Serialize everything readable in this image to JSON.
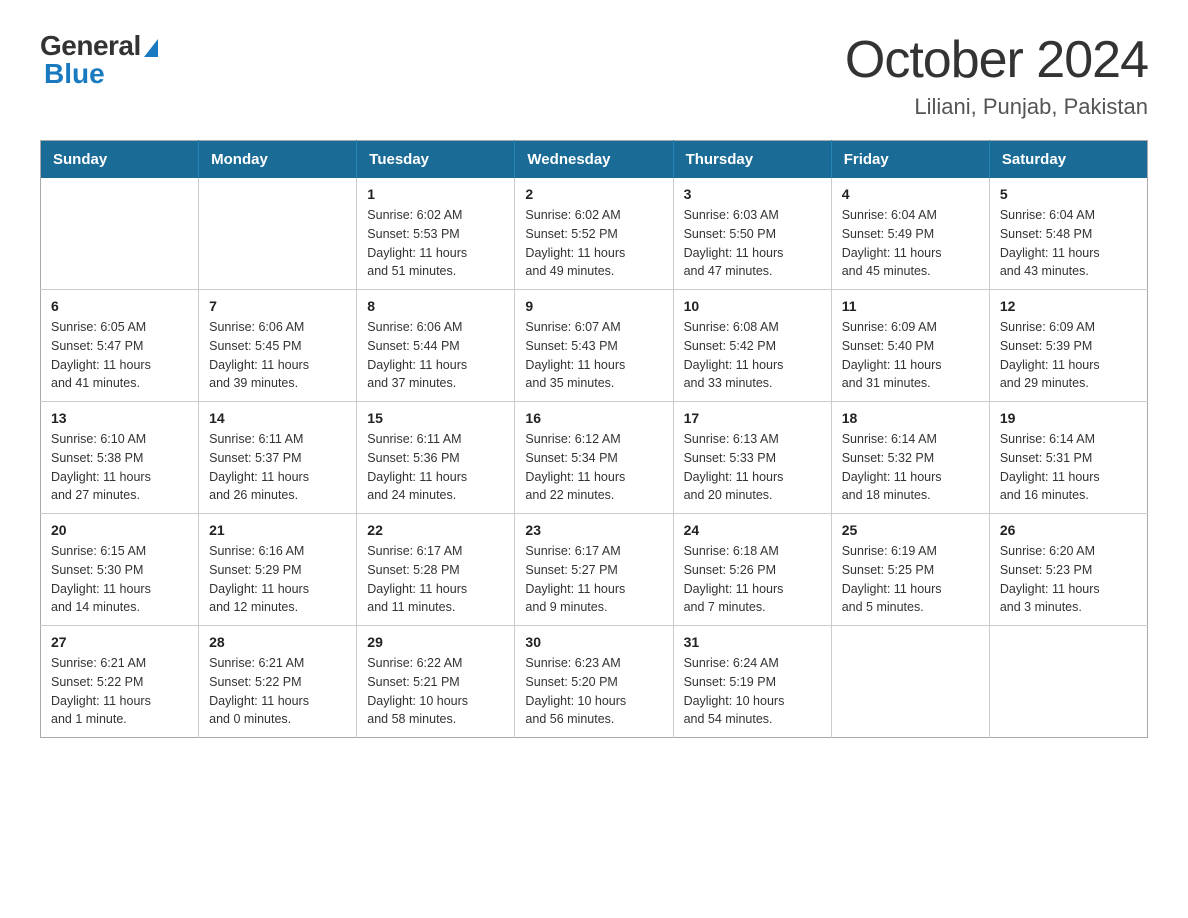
{
  "logo": {
    "general": "General",
    "blue": "Blue"
  },
  "title": "October 2024",
  "subtitle": "Liliani, Punjab, Pakistan",
  "weekdays": [
    "Sunday",
    "Monday",
    "Tuesday",
    "Wednesday",
    "Thursday",
    "Friday",
    "Saturday"
  ],
  "weeks": [
    [
      {
        "day": "",
        "info": ""
      },
      {
        "day": "",
        "info": ""
      },
      {
        "day": "1",
        "info": "Sunrise: 6:02 AM\nSunset: 5:53 PM\nDaylight: 11 hours\nand 51 minutes."
      },
      {
        "day": "2",
        "info": "Sunrise: 6:02 AM\nSunset: 5:52 PM\nDaylight: 11 hours\nand 49 minutes."
      },
      {
        "day": "3",
        "info": "Sunrise: 6:03 AM\nSunset: 5:50 PM\nDaylight: 11 hours\nand 47 minutes."
      },
      {
        "day": "4",
        "info": "Sunrise: 6:04 AM\nSunset: 5:49 PM\nDaylight: 11 hours\nand 45 minutes."
      },
      {
        "day": "5",
        "info": "Sunrise: 6:04 AM\nSunset: 5:48 PM\nDaylight: 11 hours\nand 43 minutes."
      }
    ],
    [
      {
        "day": "6",
        "info": "Sunrise: 6:05 AM\nSunset: 5:47 PM\nDaylight: 11 hours\nand 41 minutes."
      },
      {
        "day": "7",
        "info": "Sunrise: 6:06 AM\nSunset: 5:45 PM\nDaylight: 11 hours\nand 39 minutes."
      },
      {
        "day": "8",
        "info": "Sunrise: 6:06 AM\nSunset: 5:44 PM\nDaylight: 11 hours\nand 37 minutes."
      },
      {
        "day": "9",
        "info": "Sunrise: 6:07 AM\nSunset: 5:43 PM\nDaylight: 11 hours\nand 35 minutes."
      },
      {
        "day": "10",
        "info": "Sunrise: 6:08 AM\nSunset: 5:42 PM\nDaylight: 11 hours\nand 33 minutes."
      },
      {
        "day": "11",
        "info": "Sunrise: 6:09 AM\nSunset: 5:40 PM\nDaylight: 11 hours\nand 31 minutes."
      },
      {
        "day": "12",
        "info": "Sunrise: 6:09 AM\nSunset: 5:39 PM\nDaylight: 11 hours\nand 29 minutes."
      }
    ],
    [
      {
        "day": "13",
        "info": "Sunrise: 6:10 AM\nSunset: 5:38 PM\nDaylight: 11 hours\nand 27 minutes."
      },
      {
        "day": "14",
        "info": "Sunrise: 6:11 AM\nSunset: 5:37 PM\nDaylight: 11 hours\nand 26 minutes."
      },
      {
        "day": "15",
        "info": "Sunrise: 6:11 AM\nSunset: 5:36 PM\nDaylight: 11 hours\nand 24 minutes."
      },
      {
        "day": "16",
        "info": "Sunrise: 6:12 AM\nSunset: 5:34 PM\nDaylight: 11 hours\nand 22 minutes."
      },
      {
        "day": "17",
        "info": "Sunrise: 6:13 AM\nSunset: 5:33 PM\nDaylight: 11 hours\nand 20 minutes."
      },
      {
        "day": "18",
        "info": "Sunrise: 6:14 AM\nSunset: 5:32 PM\nDaylight: 11 hours\nand 18 minutes."
      },
      {
        "day": "19",
        "info": "Sunrise: 6:14 AM\nSunset: 5:31 PM\nDaylight: 11 hours\nand 16 minutes."
      }
    ],
    [
      {
        "day": "20",
        "info": "Sunrise: 6:15 AM\nSunset: 5:30 PM\nDaylight: 11 hours\nand 14 minutes."
      },
      {
        "day": "21",
        "info": "Sunrise: 6:16 AM\nSunset: 5:29 PM\nDaylight: 11 hours\nand 12 minutes."
      },
      {
        "day": "22",
        "info": "Sunrise: 6:17 AM\nSunset: 5:28 PM\nDaylight: 11 hours\nand 11 minutes."
      },
      {
        "day": "23",
        "info": "Sunrise: 6:17 AM\nSunset: 5:27 PM\nDaylight: 11 hours\nand 9 minutes."
      },
      {
        "day": "24",
        "info": "Sunrise: 6:18 AM\nSunset: 5:26 PM\nDaylight: 11 hours\nand 7 minutes."
      },
      {
        "day": "25",
        "info": "Sunrise: 6:19 AM\nSunset: 5:25 PM\nDaylight: 11 hours\nand 5 minutes."
      },
      {
        "day": "26",
        "info": "Sunrise: 6:20 AM\nSunset: 5:23 PM\nDaylight: 11 hours\nand 3 minutes."
      }
    ],
    [
      {
        "day": "27",
        "info": "Sunrise: 6:21 AM\nSunset: 5:22 PM\nDaylight: 11 hours\nand 1 minute."
      },
      {
        "day": "28",
        "info": "Sunrise: 6:21 AM\nSunset: 5:22 PM\nDaylight: 11 hours\nand 0 minutes."
      },
      {
        "day": "29",
        "info": "Sunrise: 6:22 AM\nSunset: 5:21 PM\nDaylight: 10 hours\nand 58 minutes."
      },
      {
        "day": "30",
        "info": "Sunrise: 6:23 AM\nSunset: 5:20 PM\nDaylight: 10 hours\nand 56 minutes."
      },
      {
        "day": "31",
        "info": "Sunrise: 6:24 AM\nSunset: 5:19 PM\nDaylight: 10 hours\nand 54 minutes."
      },
      {
        "day": "",
        "info": ""
      },
      {
        "day": "",
        "info": ""
      }
    ]
  ]
}
